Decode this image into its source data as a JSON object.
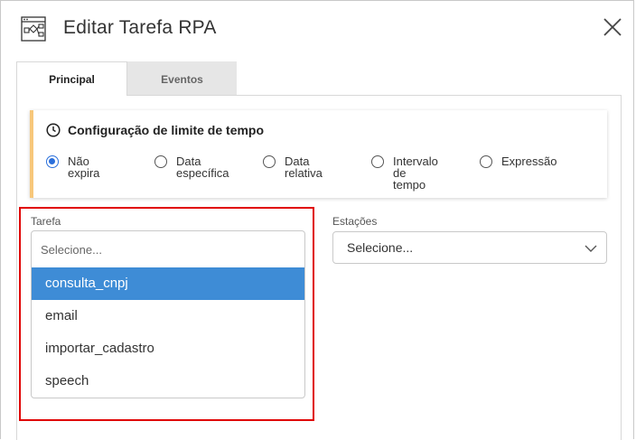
{
  "dialog": {
    "title": "Editar Tarefa RPA",
    "header_icon": "workflow-diagram-icon",
    "close_icon": "close-icon"
  },
  "tabs": [
    {
      "label": "Principal",
      "active": true
    },
    {
      "label": "Eventos",
      "active": false
    }
  ],
  "timeout": {
    "title": "Configuração de limite de tempo",
    "icon": "clock-icon",
    "accent_color": "#f7c77a",
    "options": [
      {
        "label": "Não expira",
        "checked": true
      },
      {
        "label": "Data\nespecífica",
        "checked": false
      },
      {
        "label": "Data relativa",
        "checked": false
      },
      {
        "label": "Intervalo de\ntempo",
        "checked": false
      },
      {
        "label": "Expressão",
        "checked": false
      }
    ]
  },
  "tarefa": {
    "label": "Tarefa",
    "placeholder": "Selecione...",
    "options": [
      "consulta_cnpj",
      "email",
      "importar_cadastro",
      "speech"
    ],
    "highlighted_option": "consulta_cnpj",
    "highlight_color": "#3e8cd6"
  },
  "estacoes": {
    "label": "Estações",
    "value": "Selecione...",
    "icon": "chevron-down-icon"
  },
  "annotation": {
    "color": "#e00000"
  }
}
